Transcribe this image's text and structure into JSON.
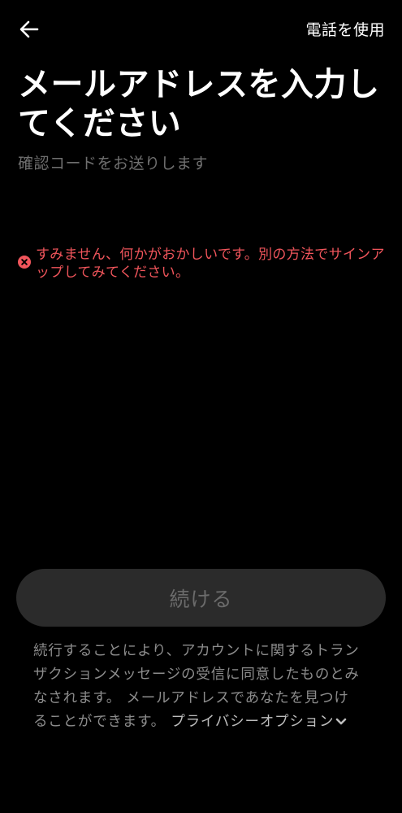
{
  "header": {
    "back_icon": "arrow-left-icon",
    "use_phone_label": "電話を使用"
  },
  "main": {
    "title": "メールアドレスを入力してください",
    "subtitle": "確認コードをお送りします",
    "error": {
      "icon": "error-circle-x-icon",
      "message": "すみません、何かがおかしいです。別の方法でサインアップしてみてください。",
      "color": "#f0555b"
    },
    "continue_label": "続ける"
  },
  "footer": {
    "terms_text": "続行することにより、アカウントに関するトランザクションメッセージの受信に同意したものとみなされます。 メールアドレスであなたを見つけることができます。 ",
    "privacy_link": "プライバシーオプション",
    "privacy_icon": "chevron-down-icon"
  },
  "colors": {
    "background": "#000000",
    "button_bg": "#2b2b2b",
    "error": "#f0555b"
  }
}
